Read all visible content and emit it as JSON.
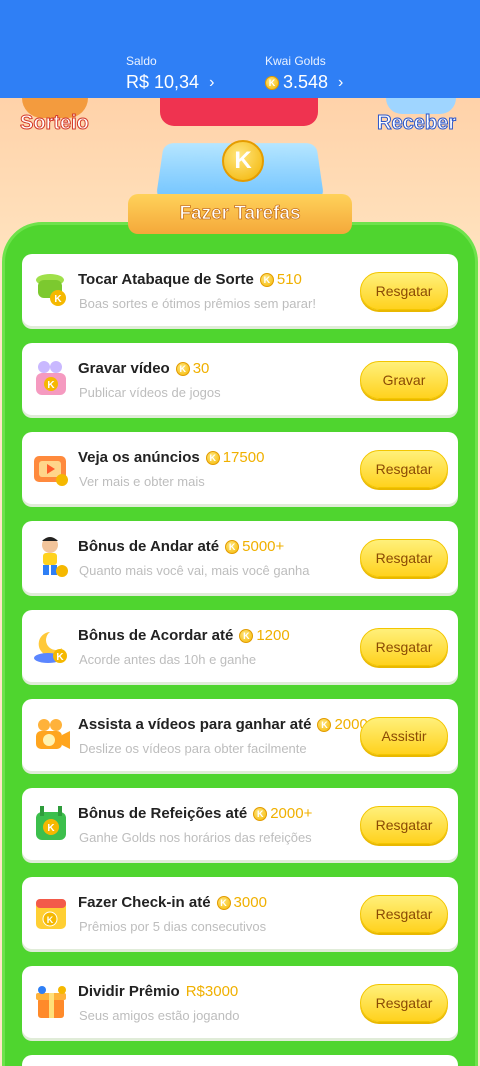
{
  "header": {
    "saldo_label": "Saldo",
    "saldo_value": "R$ 10,34",
    "golds_label": "Kwai Golds",
    "golds_value": "3.548",
    "chevron": "›"
  },
  "banner": {
    "sorteio": "Sorteio",
    "receber": "Receber",
    "title": "Fazer Tarefas",
    "coin_letter": "K"
  },
  "tasks": [
    {
      "title": "Tocar Atabaque de Sorte",
      "reward": "510",
      "subtitle": "Boas sortes e ótimos prêmios sem parar!",
      "button": "Resgatar",
      "icon": "drum-icon"
    },
    {
      "title": "Gravar vídeo",
      "reward": "30",
      "subtitle": "Publicar vídeos de jogos",
      "button": "Gravar",
      "icon": "camera-icon"
    },
    {
      "title": "Veja os anúncios",
      "reward": "17500",
      "subtitle": "Ver mais e obter mais",
      "button": "Resgatar",
      "icon": "tv-icon"
    },
    {
      "title": "Bônus de Andar até",
      "reward": "5000+",
      "subtitle": "Quanto mais você vai, mais você ganha",
      "button": "Resgatar",
      "icon": "runner-icon"
    },
    {
      "title": "Bônus de Acordar até",
      "reward": "1200",
      "subtitle": "Acorde antes das 10h e ganhe",
      "button": "Resgatar",
      "icon": "moon-icon"
    },
    {
      "title": "Assista a vídeos para ganhar até",
      "reward": "2000",
      "subtitle": "Deslize os vídeos para obter facilmente",
      "button": "Assistir",
      "icon": "video-camera-icon"
    },
    {
      "title": "Bônus de Refeições até",
      "reward": "2000+",
      "subtitle": "Ganhe Golds nos horários das refeições",
      "button": "Resgatar",
      "icon": "meal-icon"
    },
    {
      "title": "Fazer Check-in até",
      "reward": "3000",
      "subtitle": "Prêmios por 5 dias consecutivos",
      "button": "Resgatar",
      "icon": "calendar-icon"
    },
    {
      "title": "Dividir Prêmio",
      "reward": "R$3000",
      "subtitle": "Seus amigos estão jogando",
      "button": "Resgatar",
      "icon": "gift-icon"
    }
  ],
  "colors": {
    "header_blue": "#2f7ff5",
    "panel_green": "#4fd52f",
    "coin_gold": "#f5b800",
    "button_yellow": "#ffd21e"
  }
}
